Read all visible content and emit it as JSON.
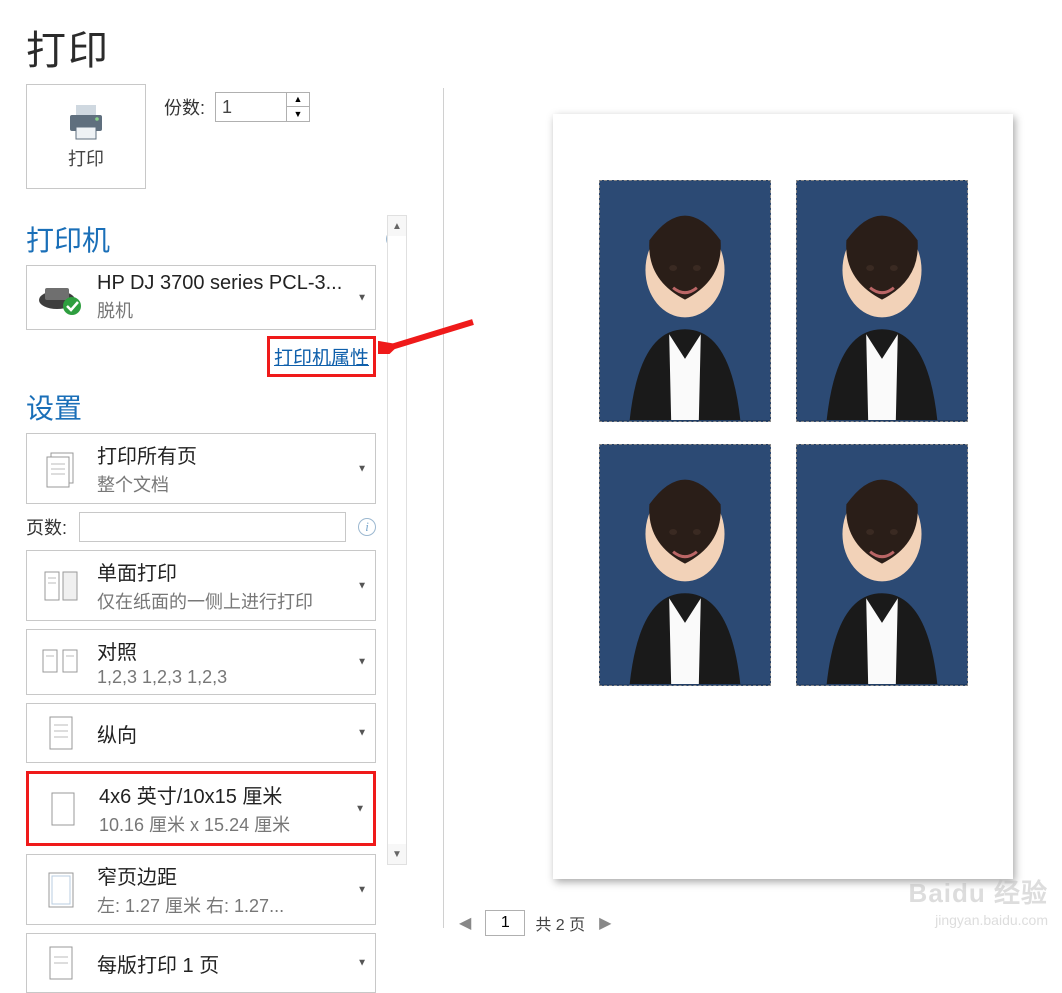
{
  "title": "打印",
  "print_button_label": "打印",
  "copies": {
    "label": "份数:",
    "value": "1"
  },
  "printer": {
    "heading": "打印机",
    "name": "HP DJ 3700 series PCL-3...",
    "status": "脱机",
    "properties_link": "打印机属性"
  },
  "settings": {
    "heading": "设置",
    "pages_label": "页数:",
    "pages_value": "",
    "items": [
      {
        "id": "print-range",
        "line1": "打印所有页",
        "line2": "整个文档",
        "icon": "doc-icon"
      },
      {
        "id": "sides",
        "line1": "单面打印",
        "line2": "仅在纸面的一侧上进行打印",
        "icon": "sides-icon"
      },
      {
        "id": "collate",
        "line1": "对照",
        "line2": "1,2,3    1,2,3    1,2,3",
        "icon": "collate-icon"
      },
      {
        "id": "orientation",
        "line1": "纵向",
        "line2": "",
        "icon": "orientation-icon"
      },
      {
        "id": "paper-size",
        "line1": "4x6 英寸/10x15 厘米",
        "line2": "10.16 厘米 x 15.24 厘米",
        "icon": "paper-icon",
        "highlight": true
      },
      {
        "id": "margins",
        "line1": "窄页边距",
        "line2": "左:  1.27 厘米    右:  1.27...",
        "icon": "margins-icon"
      },
      {
        "id": "pages-per-sheet",
        "line1": "每版打印 1 页",
        "line2": "",
        "icon": "sheet-icon"
      }
    ]
  },
  "preview": {
    "page_input": "1",
    "pager_text": "共 2 页"
  },
  "watermark": {
    "brand": "Baidu 经验",
    "url": "jingyan.baidu.com"
  },
  "icons": {
    "info": "i",
    "caret": "▼",
    "up": "▲",
    "down": "▼",
    "left": "◀",
    "right": "▶"
  }
}
